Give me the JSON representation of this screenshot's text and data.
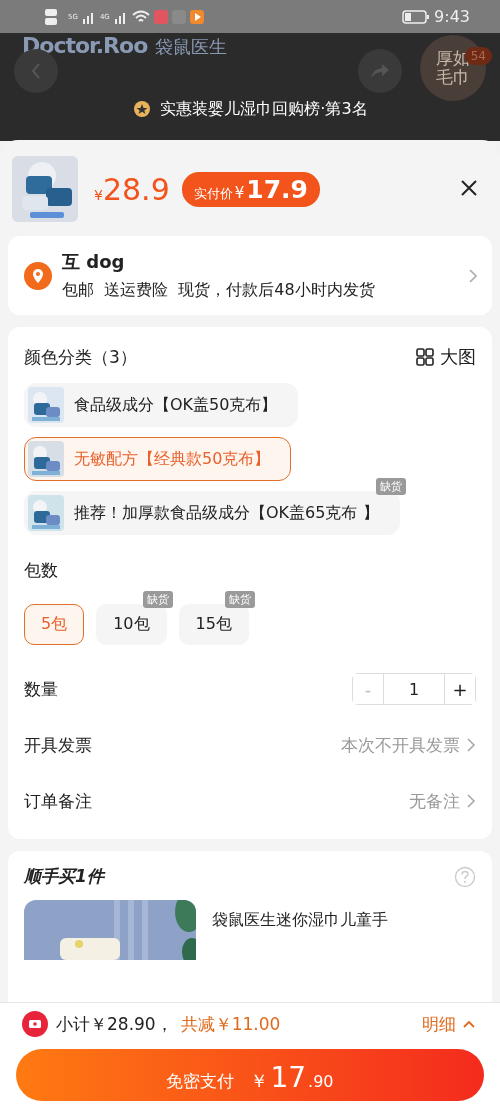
{
  "status_bar": {
    "time": "9:43",
    "network_1": "5G",
    "network_2": "4G"
  },
  "background": {
    "logo": "Doctor.Roo",
    "logo_cn": "袋鼠医生",
    "badge_line_1": "厚如",
    "badge_line_2": "毛巾",
    "cart_count": "54"
  },
  "ranking": "实惠装婴儿湿巾回购榜·第3名",
  "price": {
    "currency": "¥",
    "value": "28.9",
    "final_label": "实付价",
    "final_currency": "¥",
    "final_value": "17.9"
  },
  "address": {
    "name": "互 dog",
    "details": "包邮  送运费险  现货，付款后48小时内发货"
  },
  "colors": {
    "title": "颜色分类（3）",
    "view_label": "大图",
    "options": [
      {
        "label": "食品级成分【OK盖50克布】",
        "selected": false
      },
      {
        "label": "无敏配方【经典款50克布】",
        "selected": true
      },
      {
        "label": "推荐！加厚款食品级成分【OK盖65克布 】",
        "selected": false,
        "badge": "缺货"
      }
    ]
  },
  "packs": {
    "title": "包数",
    "options": [
      {
        "label": "5包",
        "selected": true
      },
      {
        "label": "10包",
        "selected": false,
        "badge": "缺货"
      },
      {
        "label": "15包",
        "selected": false,
        "badge": "缺货"
      }
    ]
  },
  "quantity": {
    "label": "数量",
    "minus": "-",
    "value": "1",
    "plus": "+",
    "minus_disabled": true
  },
  "rows": [
    {
      "label": "开具发票",
      "value": "本次不开具发票"
    },
    {
      "label": "订单备注",
      "value": "无备注"
    }
  ],
  "addon": {
    "title": "顺手买1件",
    "product_title": "袋鼠医生迷你湿巾儿童手"
  },
  "footer": {
    "subtotal": "小计￥28.90，",
    "discount": "共减￥11.00",
    "detail": "明细",
    "pay_label": "免密支付",
    "pay_currency": "￥",
    "pay_integer": "17",
    "pay_decimals": ".90"
  }
}
